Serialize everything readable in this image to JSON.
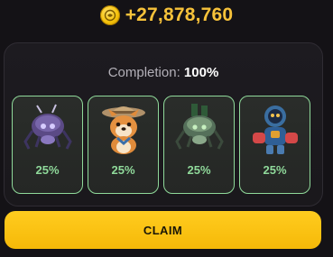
{
  "reward": {
    "amount": "+27,878,760",
    "icon": "gold-coin-icon"
  },
  "panel": {
    "completion_label": "Completion: ",
    "completion_value": "100%"
  },
  "cards": [
    {
      "creature": "purple-robot-spider",
      "percent": "25%"
    },
    {
      "creature": "shiba-dog-safari-hat",
      "percent": "25%"
    },
    {
      "creature": "green-robot-spider",
      "percent": "25%"
    },
    {
      "creature": "blue-astronaut-robot",
      "percent": "25%"
    }
  ],
  "claim": {
    "label": "CLAIM"
  },
  "colors": {
    "background": "#141216",
    "accent_gold": "#f7c23a",
    "card_border": "#8fd99a",
    "percent_text": "#8fd99a",
    "claim_button": "#ffcc1f"
  }
}
